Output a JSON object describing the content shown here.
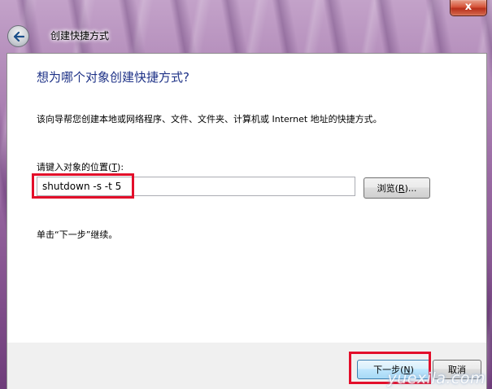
{
  "window": {
    "title": "创建快捷方式",
    "close_symbol": "x"
  },
  "page": {
    "heading": "想为哪个对象创建快捷方式?",
    "description": "该向导帮您创建本地或网络程序、文件、文件夹、计算机或 Internet 地址的快捷方式。",
    "field_label_prefix": "请键入对象的位置(",
    "field_label_key": "T",
    "field_label_suffix": "):",
    "location_value": "shutdown -s -t 5",
    "browse_prefix": "浏览(",
    "browse_key": "R",
    "browse_suffix": ")...",
    "hint": "单击“下一步”继续。"
  },
  "footer": {
    "next_prefix": "下一步(",
    "next_key": "N",
    "next_suffix": ")",
    "cancel_label": "取消"
  },
  "watermark": "yuexila.com",
  "colors": {
    "heading": "#1e3287",
    "highlight": "#e30e2a",
    "close_button": "#c8402a"
  },
  "icons": {
    "back": "back-arrow-icon",
    "close": "close-icon"
  }
}
